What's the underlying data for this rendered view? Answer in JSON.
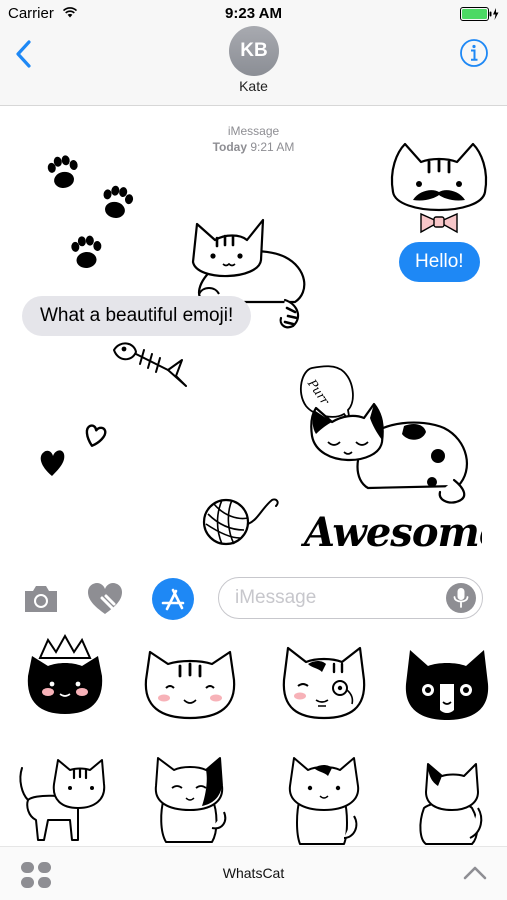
{
  "status": {
    "carrier": "Carrier",
    "time": "9:23 AM"
  },
  "contact": {
    "initials": "KB",
    "name": "Kate"
  },
  "conversation": {
    "service": "iMessage",
    "day": "Today",
    "time": "9:21 AM"
  },
  "messages": {
    "incoming": "What a beautiful emoji!",
    "outgoing": "Hello!"
  },
  "stickers": {
    "purr_text": "Purr",
    "awesome_text": "Awesome"
  },
  "composer": {
    "placeholder": "iMessage"
  },
  "app_drawer": {
    "app_name": "WhatsCat"
  },
  "icons": [
    "wifi-icon",
    "battery-icon",
    "back-icon",
    "info-icon",
    "camera-icon",
    "heart-icon",
    "appstore-icon",
    "mic-icon",
    "apps-icon",
    "chevron-up-icon"
  ],
  "colors": {
    "accent": "#1e88f5",
    "bubble_in": "#e5e5ea",
    "battery": "#4cd964"
  }
}
